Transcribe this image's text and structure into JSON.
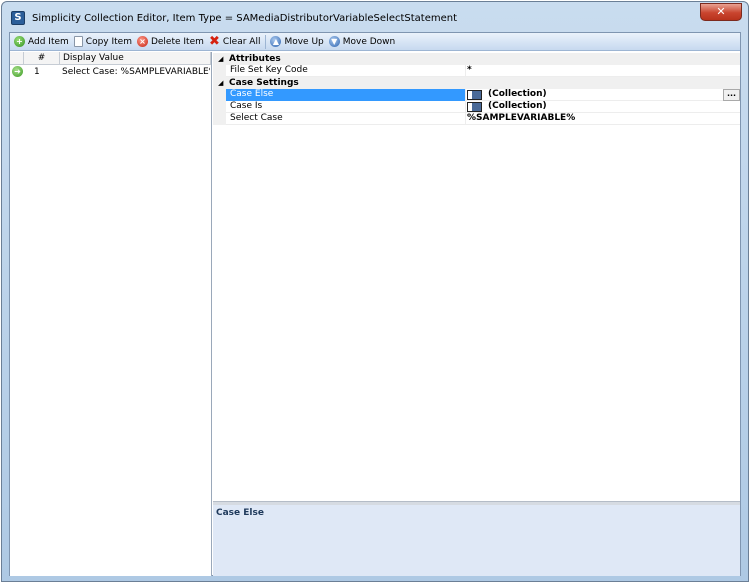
{
  "window": {
    "title": "Simplicity Collection Editor, Item Type = SAMediaDistributorVariableSelectStatement",
    "app_icon_letter": "S",
    "close_glyph": "✕"
  },
  "toolbar": {
    "add_label": "Add Item",
    "copy_label": "Copy Item",
    "delete_label": "Delete Item",
    "clear_label": "Clear All",
    "move_up_label": "Move Up",
    "move_down_label": "Move Down",
    "clear_glyph": "✖"
  },
  "item_grid": {
    "headers": {
      "number": "#",
      "display_value": "Display Value"
    },
    "rows": [
      {
        "number": "1",
        "display_value": "Select Case: %SAMPLEVARIABLE% - *",
        "indicator_glyph": "➜"
      }
    ]
  },
  "property_grid": {
    "categories": [
      {
        "label": "Attributes",
        "collapse_glyph": "◢"
      },
      {
        "label": "Case Settings",
        "collapse_glyph": "◢"
      }
    ],
    "properties": [
      {
        "name": "File Set Key Code",
        "value": "*"
      },
      {
        "name": "Case Else",
        "value": "(Collection)",
        "selected": true
      },
      {
        "name": "Case Is",
        "value": "(Collection)"
      },
      {
        "name": "Select Case",
        "value": "%SAMPLEVARIABLE%"
      }
    ],
    "ellipsis": "..."
  },
  "help": {
    "title": "Case Else"
  },
  "colors": {
    "selection": "#3399ff",
    "help_background": "#dfe8f6",
    "toolbar_top": "#eaf2fb",
    "toolbar_bottom": "#c7d9ef"
  }
}
